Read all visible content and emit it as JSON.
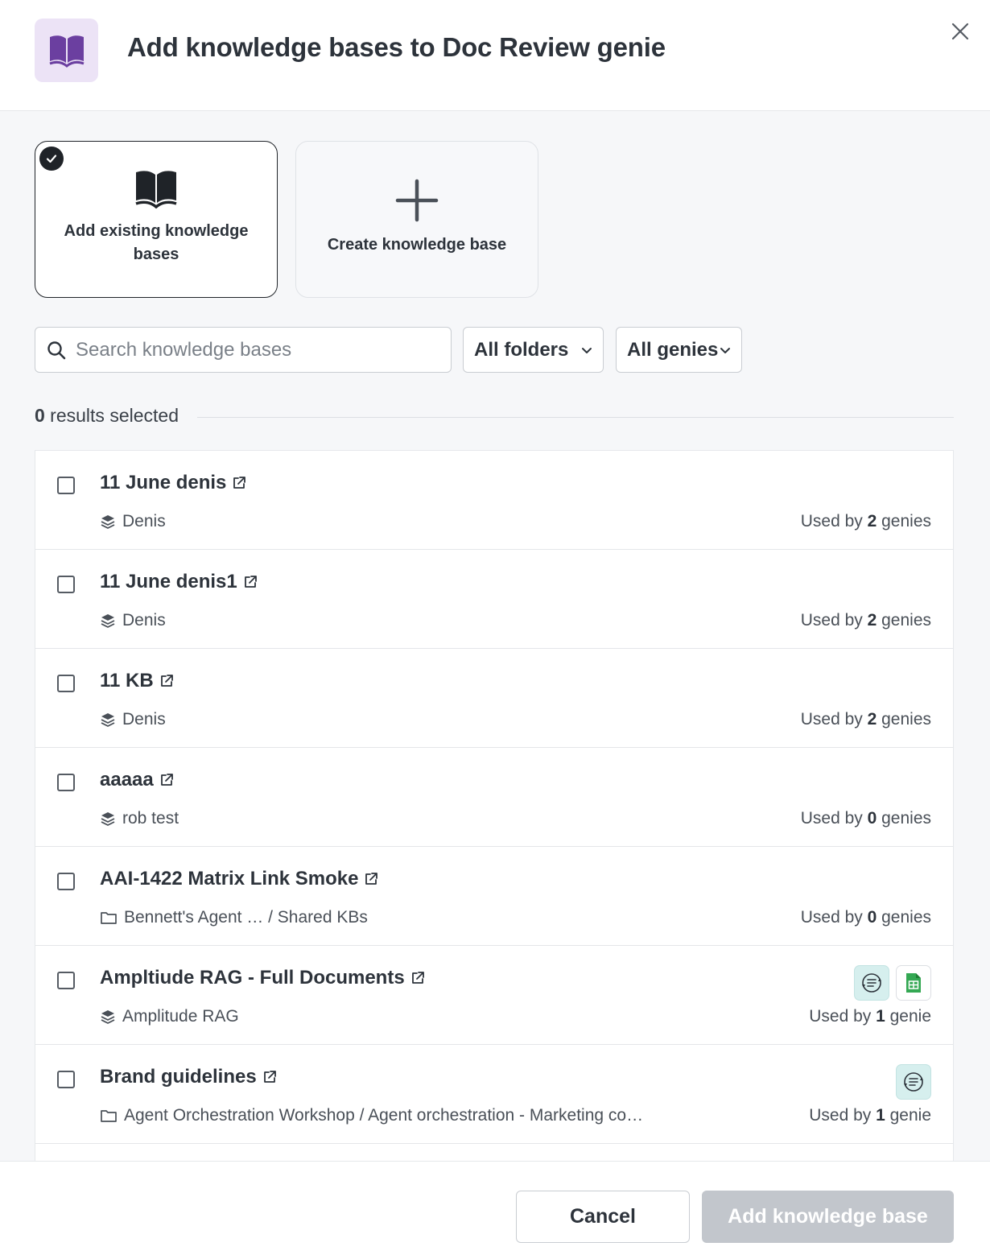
{
  "header": {
    "title": "Add knowledge bases to Doc Review genie",
    "icon": "book-open-icon",
    "accent": "#6b3fa0"
  },
  "options": {
    "existing_label": "Add existing knowledge bases",
    "create_label": "Create knowledge base"
  },
  "filters": {
    "search_placeholder": "Search knowledge bases",
    "search_value": "",
    "folder_value": "All folders",
    "genie_value": "All genies"
  },
  "results": {
    "count": "0",
    "suffix": " results selected"
  },
  "used_by_prefix": "Used by ",
  "items": [
    {
      "name": "11 June denis",
      "location": "Denis",
      "location_type": "stack",
      "count": "2",
      "unit": " genies",
      "badges": []
    },
    {
      "name": "11 June denis1",
      "location": "Denis",
      "location_type": "stack",
      "count": "2",
      "unit": " genies",
      "badges": []
    },
    {
      "name": "11 KB",
      "location": "Denis",
      "location_type": "stack",
      "count": "2",
      "unit": " genies",
      "badges": []
    },
    {
      "name": "aaaaa",
      "location": "rob test",
      "location_type": "stack",
      "count": "0",
      "unit": " genies",
      "badges": []
    },
    {
      "name": "AAI-1422 Matrix Link Smoke",
      "location": "Bennett's Agent … / Shared KBs",
      "location_type": "folder",
      "count": "0",
      "unit": " genies",
      "badges": []
    },
    {
      "name": "Ampltiude RAG - Full Documents",
      "location": "Amplitude RAG",
      "location_type": "stack",
      "count": "1",
      "unit": " genie",
      "badges": [
        "sync",
        "sheet"
      ]
    },
    {
      "name": "Brand guidelines",
      "location": "Agent Orchestration Workshop / Agent orchestration - Marketing co…",
      "location_type": "folder",
      "count": "1",
      "unit": " genie",
      "badges": [
        "sync"
      ]
    },
    {
      "name": "",
      "location": "",
      "location_type": "stack",
      "count": "",
      "unit": "",
      "badges": []
    }
  ],
  "footer": {
    "cancel_label": "Cancel",
    "add_label": "Add knowledge base"
  }
}
